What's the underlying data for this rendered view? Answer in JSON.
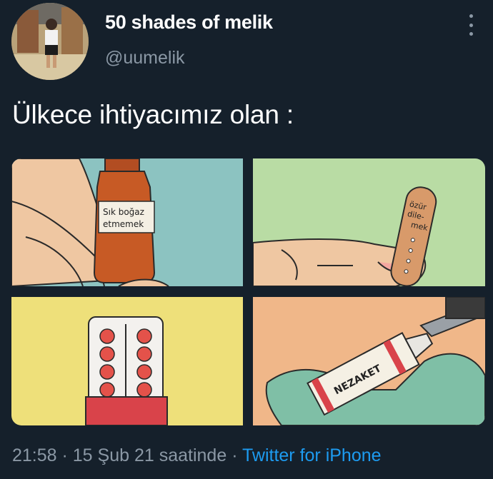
{
  "tweet": {
    "display_name": "50 shades of melik",
    "handle": "@uumelik",
    "text": "Ülkece ihtiyacımız olan :",
    "time": "21:58",
    "separator": " · ",
    "date": "15 Şub 21 saatinde",
    "separator2": " · ",
    "source": "Twitter for iPhone"
  },
  "media": {
    "panel1_label": [
      "Sık boğaz",
      "etmemek"
    ],
    "panel2_label": [
      "özür",
      "dile-",
      "mek"
    ],
    "panel4_label": "NEZAKET"
  },
  "colors": {
    "background": "#15202b",
    "link": "#1d9bf0",
    "secondary_text": "#8b98a5"
  }
}
